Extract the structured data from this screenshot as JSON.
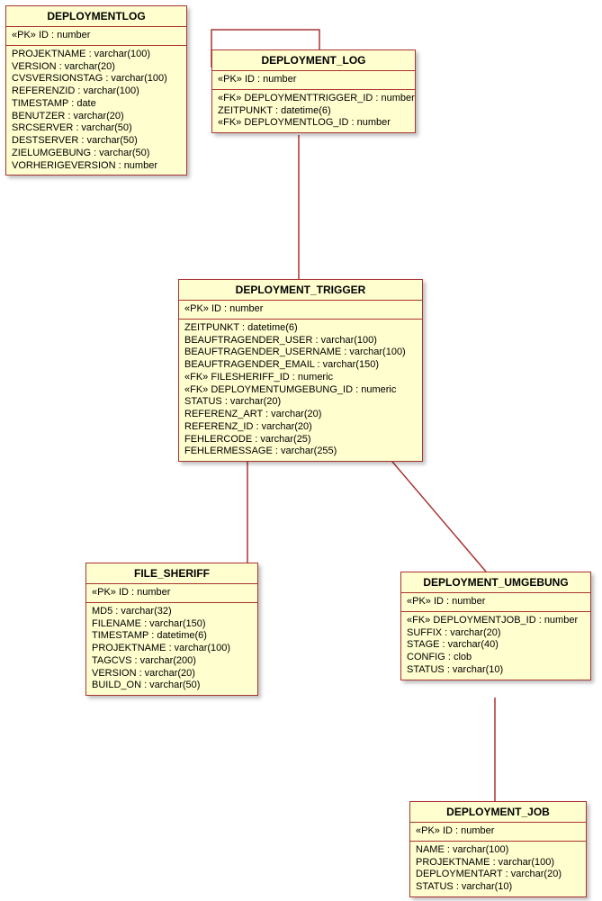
{
  "entities": {
    "deploymentlog": {
      "title": "DEPLOYMENTLOG",
      "pk": "«PK» ID : number",
      "rows": [
        "PROJEKTNAME : varchar(100)",
        "VERSION : varchar(20)",
        "CVSVERSIONSTAG : varchar(100)",
        "REFERENZID : varchar(100)",
        "TIMESTAMP : date",
        "BENUTZER : varchar(20)",
        "SRCSERVER : varchar(50)",
        "DESTSERVER : varchar(50)",
        "ZIELUMGEBUNG : varchar(50)",
        "VORHERIGEVERSION : number"
      ]
    },
    "deployment_log": {
      "title": "DEPLOYMENT_LOG",
      "pk": "«PK» ID : number",
      "rows": [
        "«FK» DEPLOYMENTTRIGGER_ID : number",
        "ZEITPUNKT : datetime(6)",
        "«FK» DEPLOYMENTLOG_ID : number"
      ]
    },
    "deployment_trigger": {
      "title": "DEPLOYMENT_TRIGGER",
      "pk": "«PK» ID : number",
      "rows": [
        "ZEITPUNKT : datetime(6)",
        "BEAUFTRAGENDER_USER : varchar(100)",
        "BEAUFTRAGENDER_USERNAME : varchar(100)",
        "BEAUFTRAGENDER_EMAIL : varchar(150)",
        "«FK» FILESHERIFF_ID : numeric",
        "«FK» DEPLOYMENTUMGEBUNG_ID : numeric",
        "STATUS : varchar(20)",
        "REFERENZ_ART : varchar(20)",
        "REFERENZ_ID : varchar(20)",
        "FEHLERCODE : varchar(25)",
        "FEHLERMESSAGE : varchar(255)"
      ]
    },
    "file_sheriff": {
      "title": "FILE_SHERIFF",
      "pk": "«PK» ID : number",
      "rows": [
        "MD5 : varchar(32)",
        "FILENAME : varchar(150)",
        "TIMESTAMP : datetime(6)",
        "PROJEKTNAME : varchar(100)",
        "TAGCVS : varchar(200)",
        "VERSION : varchar(20)",
        "BUILD_ON : varchar(50)"
      ]
    },
    "deployment_umgebung": {
      "title": "DEPLOYMENT_UMGEBUNG",
      "pk": "«PK» ID : number",
      "rows": [
        "«FK» DEPLOYMENTJOB_ID : number",
        "SUFFIX : varchar(20)",
        "STAGE : varchar(40)",
        "CONFIG : clob",
        "STATUS : varchar(10)"
      ]
    },
    "deployment_job": {
      "title": "DEPLOYMENT_JOB",
      "pk": "«PK» ID : number",
      "rows": [
        "NAME : varchar(100)",
        "PROJEKTNAME : varchar(100)",
        "DEPLOYMENTART : varchar(20)",
        "STATUS : varchar(10)"
      ]
    }
  }
}
